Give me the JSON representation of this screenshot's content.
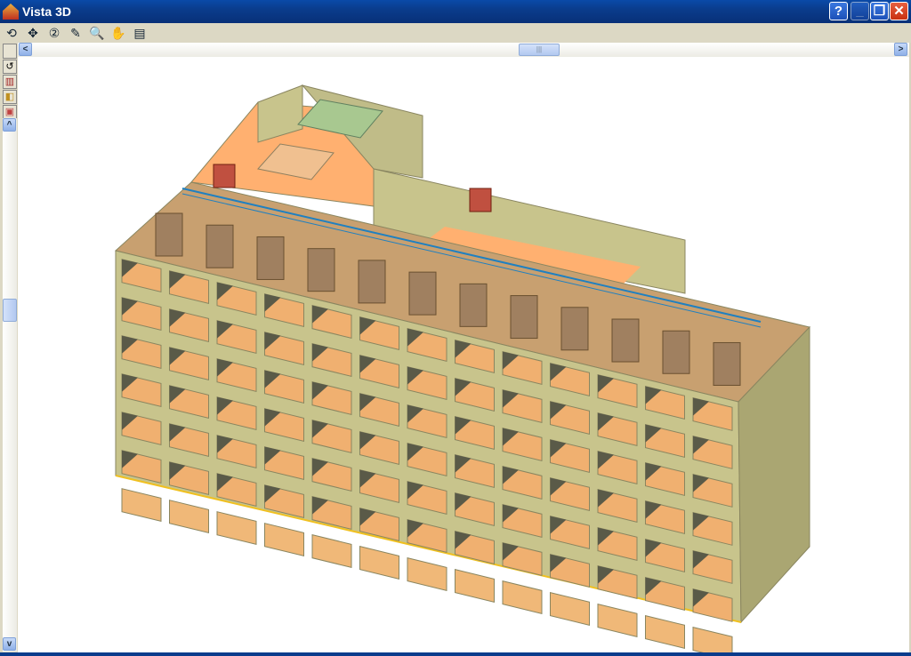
{
  "window": {
    "title": "Vista 3D",
    "buttons": {
      "help": "?",
      "minimize": "_",
      "restore": "❐",
      "close": "✕"
    }
  },
  "toolbar": {
    "tools": [
      {
        "icon": "rotate-icon",
        "glyph": "⟲"
      },
      {
        "icon": "zoom-extents-icon",
        "glyph": "✥"
      },
      {
        "icon": "zoom-x2-icon",
        "glyph": "②"
      },
      {
        "icon": "pencil-icon",
        "glyph": "✎"
      },
      {
        "icon": "zoom-window-icon",
        "glyph": "🔍"
      },
      {
        "icon": "pan-hand-icon",
        "glyph": "✋"
      },
      {
        "icon": "copy-view-icon",
        "glyph": "▤"
      }
    ]
  },
  "left_tools": [
    {
      "icon": "blank-tool-icon",
      "glyph": ""
    },
    {
      "icon": "undo-arrow-icon",
      "glyph": "↺"
    },
    {
      "icon": "books-icon",
      "glyph": "▥"
    },
    {
      "icon": "cube-icon",
      "glyph": "◧"
    },
    {
      "icon": "section-box-icon",
      "glyph": "▣"
    }
  ],
  "scroll": {
    "left": "<",
    "right": ">",
    "up": "^",
    "down": "v",
    "thumb": "|||"
  },
  "colors": {
    "facade": "#c8c48c",
    "side": "#a8a470",
    "window": "#f0b070",
    "roof_floor": "#ffb070",
    "partition": "#a08060",
    "title": "#0a3c8c"
  }
}
